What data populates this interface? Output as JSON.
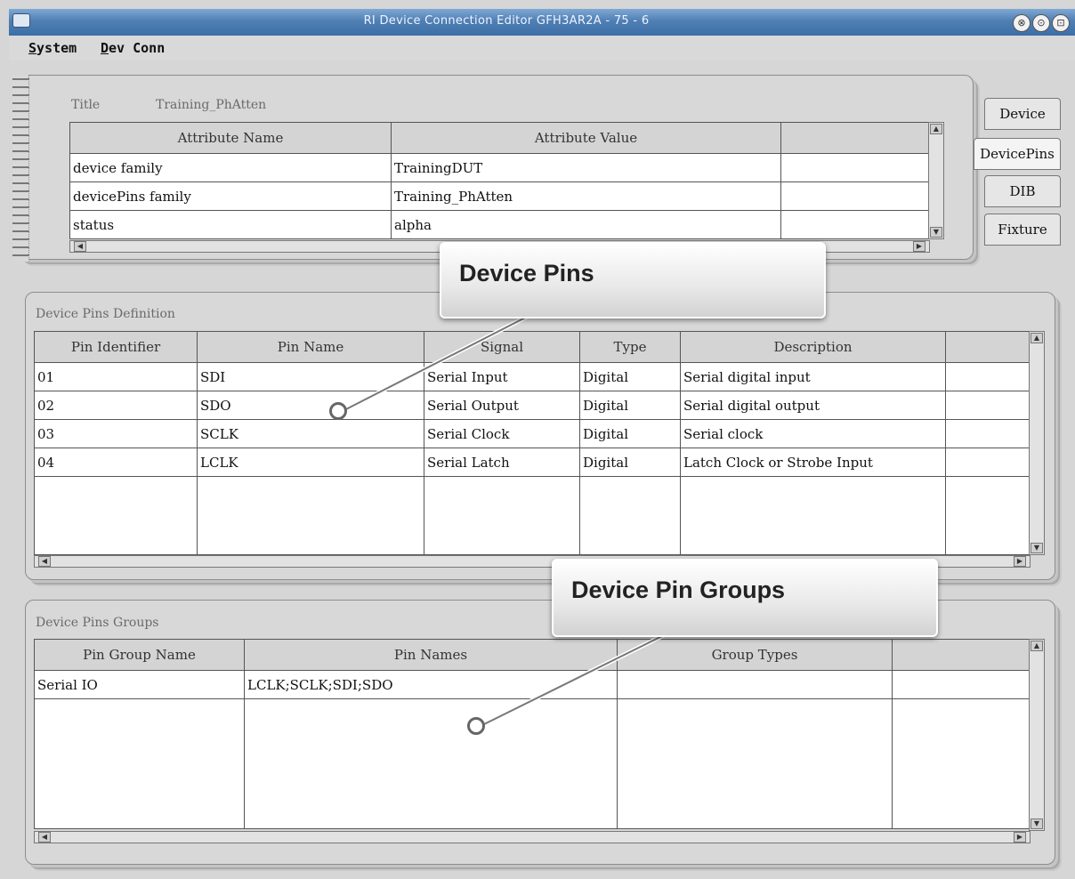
{
  "window": {
    "title": "RI Device Connection Editor GFH3AR2A - 75 - 6",
    "controls": [
      "⊗",
      "⊙",
      "⊡"
    ]
  },
  "menu": {
    "items": [
      "System",
      "Dev Conn"
    ]
  },
  "attributes": {
    "title_label": "Title",
    "title_value": "Training_PhAtten",
    "columns": [
      "Attribute Name",
      "Attribute Value",
      ""
    ],
    "rows": [
      [
        "device family",
        "TrainingDUT",
        ""
      ],
      [
        "devicePins family",
        "Training_PhAtten",
        ""
      ],
      [
        "status",
        "alpha",
        ""
      ]
    ]
  },
  "tabs": [
    "Device",
    "DevicePins",
    "DIB",
    "Fixture"
  ],
  "device_pins": {
    "section_label": "Device Pins Definition",
    "columns": [
      "Pin Identifier",
      "Pin Name",
      "Signal",
      "Type",
      "Description",
      ""
    ],
    "rows": [
      [
        "01",
        "SDI",
        "Serial Input",
        "Digital",
        "Serial digital input",
        ""
      ],
      [
        "02",
        "SDO",
        "Serial Output",
        "Digital",
        "Serial digital output",
        ""
      ],
      [
        "03",
        "SCLK",
        "Serial Clock",
        "Digital",
        "Serial clock",
        ""
      ],
      [
        "04",
        "LCLK",
        "Serial Latch",
        "Digital",
        "Latch Clock or Strobe Input",
        ""
      ]
    ]
  },
  "pin_groups": {
    "section_label": "Device Pins Groups",
    "columns": [
      "Pin Group Name",
      "Pin Names",
      "Group Types",
      ""
    ],
    "rows": [
      [
        "Serial IO",
        "LCLK;SCLK;SDI;SDO",
        "",
        ""
      ]
    ]
  },
  "callouts": {
    "device_pins": "Device Pins",
    "pin_groups": "Device Pin Groups"
  },
  "scroll_arrows": {
    "up": "▲",
    "down": "▼",
    "left": "◀",
    "right": "▶"
  }
}
